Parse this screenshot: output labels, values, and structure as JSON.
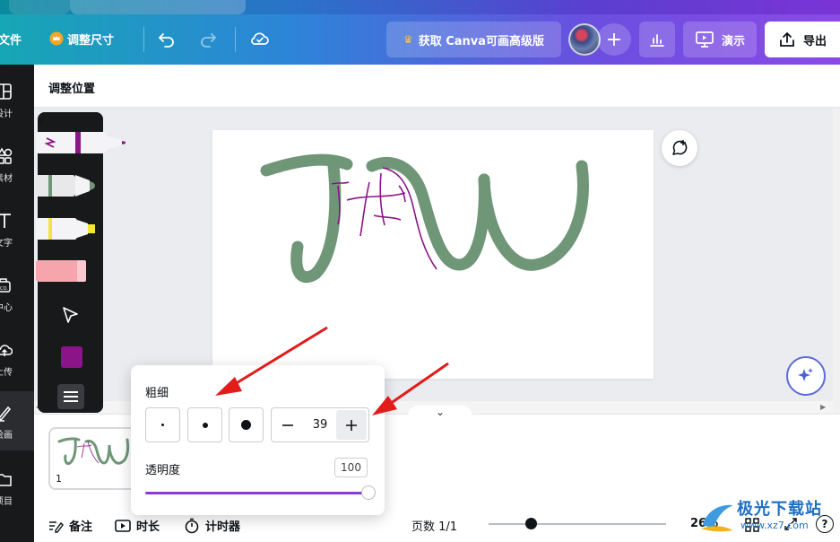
{
  "topbar": {
    "file_label": "文件",
    "resize_label": "调整尺寸",
    "pro_label": "获取 Canva可画高级版",
    "present_label": "演示",
    "export_label": "导出",
    "add_collab": "+"
  },
  "leftnav": {
    "items": [
      {
        "label": "设计",
        "icon": "layout-icon"
      },
      {
        "label": "素材",
        "icon": "shapes-icon"
      },
      {
        "label": "文字",
        "icon": "text-icon"
      },
      {
        "label": "品牌中心",
        "icon": "brand-icon"
      },
      {
        "label": "上传",
        "icon": "upload-icon"
      },
      {
        "label": "绘画",
        "icon": "draw-icon"
      },
      {
        "label": "项目",
        "icon": "folder-icon"
      }
    ],
    "visible_labels": [
      "设计",
      "素材",
      "文字",
      "中心",
      "上传",
      "绘画",
      "项目"
    ]
  },
  "context_toolbar": {
    "title": "调整位置"
  },
  "drawbar": {
    "selected_color": "#8b1488",
    "tools": [
      "marker-pen",
      "pen",
      "highlighter",
      "eraser",
      "select-arrow"
    ]
  },
  "popup": {
    "thickness_label": "粗细",
    "thickness_value": "39",
    "opacity_label": "透明度",
    "opacity_value": "100",
    "opacity_fraction": 1.0
  },
  "footer": {
    "notes_label": "备注",
    "duration_label": "时长",
    "timer_label": "计时器",
    "pages_label": "页数 1/1",
    "zoom_label": "26%",
    "help": "?"
  },
  "thumbnail": {
    "page_number": "1"
  },
  "watermark": {
    "title": "极光下载站",
    "url": "www.xz7.com"
  },
  "colors": {
    "stroke_green": "#6e9677",
    "stroke_purple": "#8b1488",
    "accent": "#8b3ad6",
    "arrow_red": "#e21b1b"
  }
}
